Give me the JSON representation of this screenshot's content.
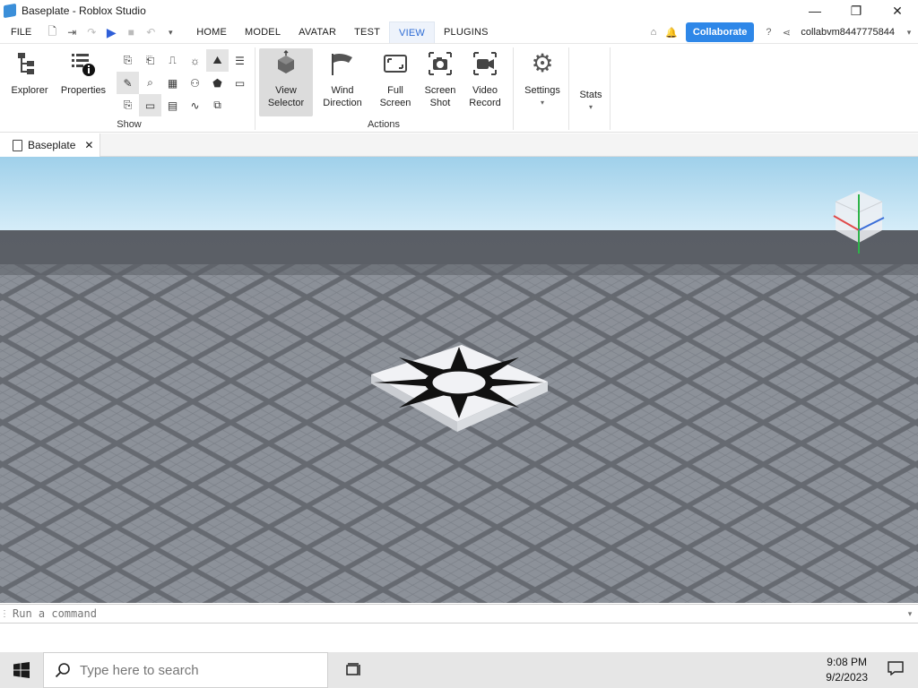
{
  "window": {
    "title": "Baseplate - Roblox Studio",
    "minimize": "—",
    "maximize": "❐",
    "close": "✕"
  },
  "menubar": {
    "file": "FILE",
    "tabs": [
      {
        "label": "HOME"
      },
      {
        "label": "MODEL"
      },
      {
        "label": "AVATAR"
      },
      {
        "label": "TEST"
      },
      {
        "label": "VIEW",
        "active": true
      },
      {
        "label": "PLUGINS"
      }
    ],
    "collaborate": "Collaborate",
    "username": "collabvm8447775844"
  },
  "ribbon": {
    "explorer": "Explorer",
    "properties": "Properties",
    "show_group": "Show",
    "view_selector": [
      "View",
      "Selector"
    ],
    "wind_direction": [
      "Wind",
      "Direction"
    ],
    "full_screen": [
      "Full",
      "Screen"
    ],
    "screen_shot": [
      "Screen",
      "Shot"
    ],
    "video_record": [
      "Video",
      "Record"
    ],
    "actions_group": "Actions",
    "settings": "Settings",
    "stats": "Stats"
  },
  "doc_tab": {
    "label": "Baseplate",
    "close": "✕"
  },
  "command": {
    "placeholder": "Run a command"
  },
  "taskbar": {
    "search_placeholder": "Type here to search",
    "time": "9:08 PM",
    "date": "9/2/2023"
  },
  "colors": {
    "accent": "#2e87e8",
    "sky_top": "#9fd0ea",
    "sky_bottom": "#d4ecf8",
    "floor": "#6a6e75"
  }
}
